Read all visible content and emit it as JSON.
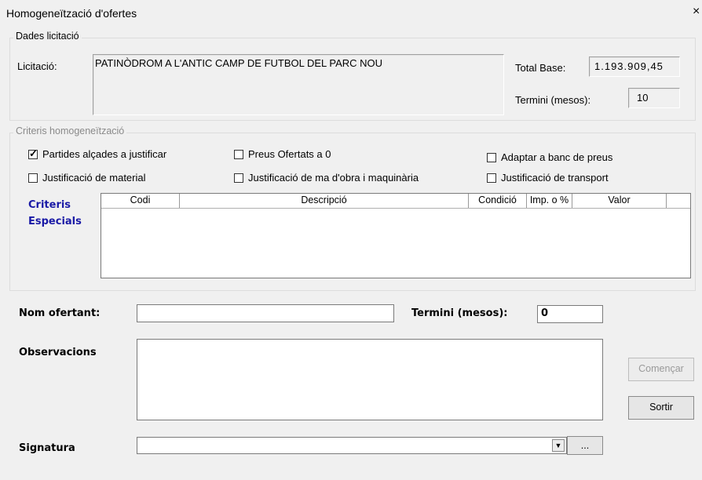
{
  "window": {
    "title": "Homogeneïtzació d'ofertes",
    "close_glyph": "×"
  },
  "dades": {
    "legend": "Dades licitació",
    "licitacio_label": "Licitació:",
    "licitacio_value": "PATINÒDROM A L'ANTIC CAMP DE FUTBOL DEL PARC NOU",
    "total_base_label": "Total Base:",
    "total_base_value": "1.193.909,45",
    "termini_label": "Termini (mesos):",
    "termini_value": "10"
  },
  "criteris": {
    "legend": "Criteris homogeneïtzació",
    "options": [
      {
        "label": "Partides alçades a justificar",
        "checked": true
      },
      {
        "label": "Preus Ofertats a 0",
        "checked": false
      },
      {
        "label": "Adaptar a banc de preus",
        "checked": false
      },
      {
        "label": "Justificació de material",
        "checked": false
      },
      {
        "label": "Justificació de ma d'obra i maquinària",
        "checked": false
      },
      {
        "label": "Justificació de transport",
        "checked": false
      }
    ],
    "especials_line1": "Criteris",
    "especials_line2": "Especials",
    "columns": [
      "Codi",
      "Descripció",
      "Condició",
      "Imp. o %",
      "Valor"
    ]
  },
  "oferta": {
    "nom_label": "Nom ofertant:",
    "nom_value": "",
    "termini_label": "Termini (mesos):",
    "termini_value": "0",
    "observacions_label": "Observacions",
    "signatura_label": "Signatura",
    "signatura_value": "",
    "browse_label": "..."
  },
  "buttons": {
    "comencar_label": "Començar",
    "comencar_enabled": false,
    "sortir_label": "Sortir"
  },
  "icons": {
    "checkbox_checked": "check-icon",
    "dropdown": "chevron-down-icon",
    "close": "close-icon"
  }
}
